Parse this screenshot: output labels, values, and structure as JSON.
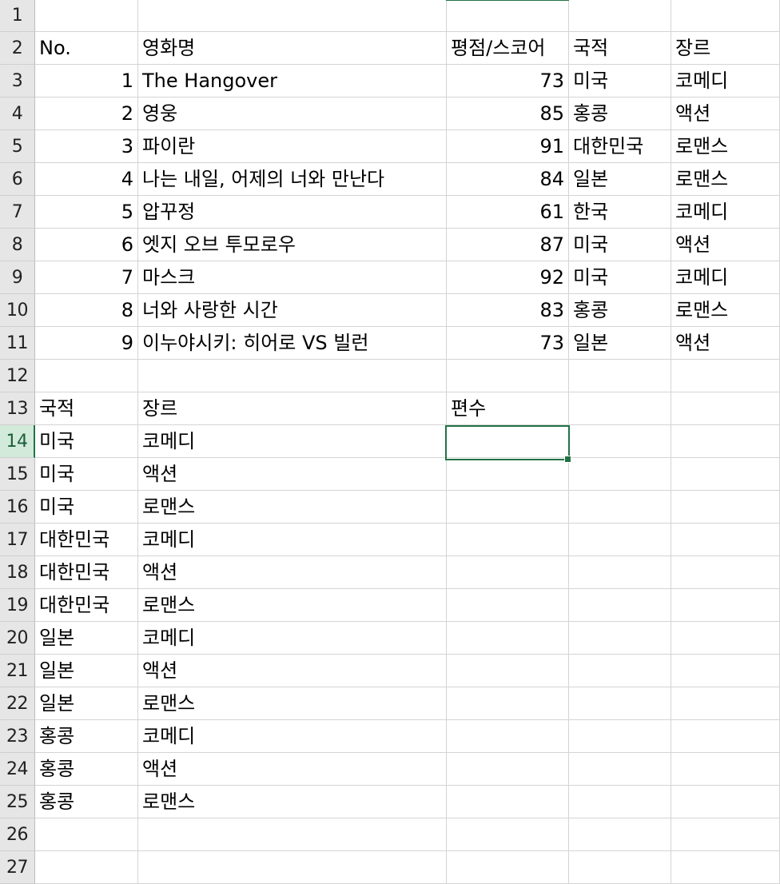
{
  "row_numbers": [
    "1",
    "2",
    "3",
    "4",
    "5",
    "6",
    "7",
    "8",
    "9",
    "10",
    "11",
    "12",
    "13",
    "14",
    "15",
    "16",
    "17",
    "18",
    "19",
    "20",
    "21",
    "22",
    "23",
    "24",
    "25",
    "26",
    "27"
  ],
  "rows": [
    [
      "",
      "",
      "",
      "",
      ""
    ],
    [
      "No.",
      "영화명",
      "평점/스코어",
      "국적",
      "장르"
    ],
    [
      "1",
      "The Hangover",
      "73",
      "미국",
      "코메디"
    ],
    [
      "2",
      "영웅",
      "85",
      "홍콩",
      "액션"
    ],
    [
      "3",
      "파이란",
      "91",
      "대한민국",
      "로맨스"
    ],
    [
      "4",
      "나는 내일, 어제의 너와 만난다",
      "84",
      "일본",
      "로맨스"
    ],
    [
      "5",
      "압꾸정",
      "61",
      "한국",
      "코메디"
    ],
    [
      "6",
      "엣지 오브 투모로우",
      "87",
      "미국",
      "액션"
    ],
    [
      "7",
      "마스크",
      "92",
      "미국",
      "코메디"
    ],
    [
      "8",
      "너와 사랑한 시간",
      "83",
      "홍콩",
      "로맨스"
    ],
    [
      "9",
      "이누야시키: 히어로 VS 빌런",
      "73",
      "일본",
      "액션"
    ],
    [
      "",
      "",
      "",
      "",
      ""
    ],
    [
      "국적",
      "장르",
      "편수",
      "",
      ""
    ],
    [
      "미국",
      "코메디",
      "",
      "",
      ""
    ],
    [
      "미국",
      "액션",
      "",
      "",
      ""
    ],
    [
      "미국",
      "로맨스",
      "",
      "",
      ""
    ],
    [
      "대한민국",
      "코메디",
      "",
      "",
      ""
    ],
    [
      "대한민국",
      "액션",
      "",
      "",
      ""
    ],
    [
      "대한민국",
      "로맨스",
      "",
      "",
      ""
    ],
    [
      "일본",
      "코메디",
      "",
      "",
      ""
    ],
    [
      "일본",
      "액션",
      "",
      "",
      ""
    ],
    [
      "일본",
      "로맨스",
      "",
      "",
      ""
    ],
    [
      "홍콩",
      "코메디",
      "",
      "",
      ""
    ],
    [
      "홍콩",
      "액션",
      "",
      "",
      ""
    ],
    [
      "홍콩",
      "로맨스",
      "",
      "",
      ""
    ],
    [
      "",
      "",
      "",
      "",
      ""
    ],
    [
      "",
      "",
      "",
      "",
      ""
    ]
  ],
  "numeric_cells": [
    [
      2,
      0
    ],
    [
      2,
      2
    ],
    [
      3,
      0
    ],
    [
      3,
      2
    ],
    [
      4,
      0
    ],
    [
      4,
      2
    ],
    [
      5,
      0
    ],
    [
      5,
      2
    ],
    [
      6,
      0
    ],
    [
      6,
      2
    ],
    [
      7,
      0
    ],
    [
      7,
      2
    ],
    [
      8,
      0
    ],
    [
      8,
      2
    ],
    [
      9,
      0
    ],
    [
      9,
      2
    ],
    [
      10,
      0
    ],
    [
      10,
      2
    ]
  ],
  "active_row_number": "14",
  "active_cell_row": "14",
  "active_column_index": 2,
  "colors": {
    "accent": "#217346",
    "active_header_bg": "#d2ead9",
    "header_bg": "#e6e6e6",
    "gridline": "#d4d4d4"
  }
}
